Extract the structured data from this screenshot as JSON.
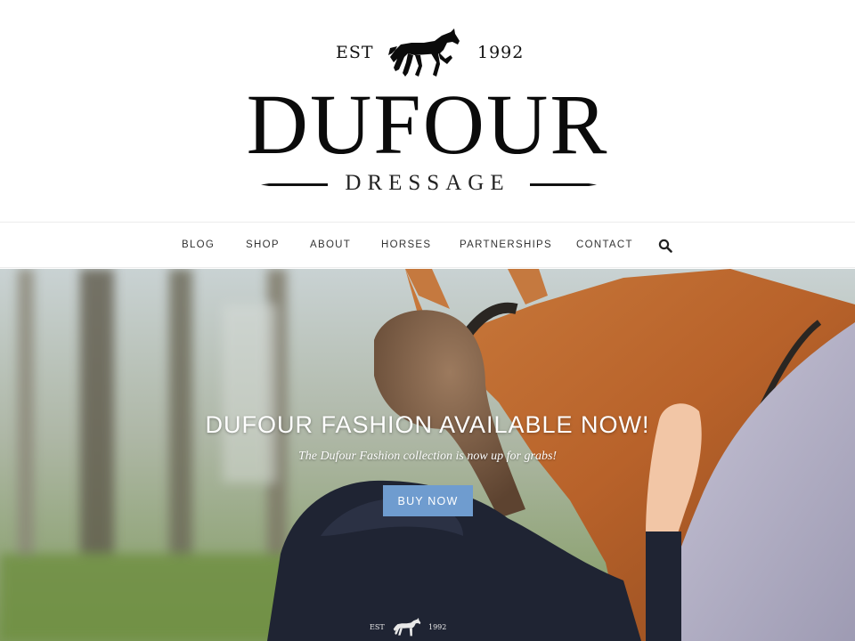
{
  "logo": {
    "est_label": "EST",
    "year": "1992",
    "brand": "DUFOUR",
    "subtitle": "DRESSAGE",
    "horse_icon": "horse-silhouette-icon"
  },
  "nav": {
    "items": [
      {
        "label": "BLOG"
      },
      {
        "label": "SHOP"
      },
      {
        "label": "ABOUT"
      },
      {
        "label": "HORSES"
      },
      {
        "label": "PARTNERSHIPS"
      },
      {
        "label": "CONTACT"
      }
    ],
    "search_icon": "search-icon"
  },
  "hero": {
    "title": "DUFOUR FASHION AVAILABLE NOW!",
    "subtitle": "The Dufour Fashion collection is now up for grabs!",
    "button_label": "BUY NOW",
    "button_color": "#6f9ccf",
    "hoodie_est": "EST",
    "hoodie_year": "1992"
  }
}
